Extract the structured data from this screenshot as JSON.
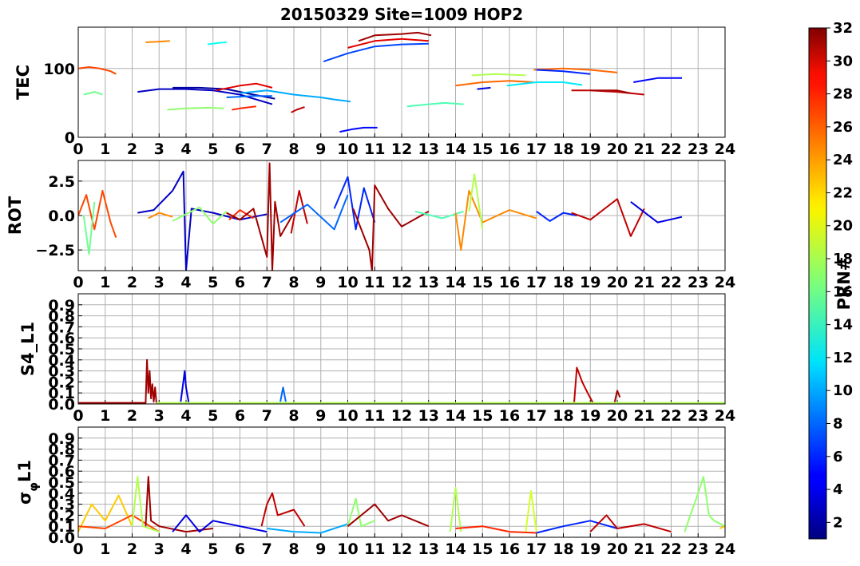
{
  "title": "20150329 Site=1009 HOP2",
  "colorbar": {
    "label": "PRN#",
    "min": 1,
    "max": 32,
    "ticks": [
      2,
      4,
      6,
      8,
      10,
      12,
      14,
      16,
      18,
      20,
      22,
      24,
      26,
      28,
      30,
      32
    ],
    "tick_labels": [
      "2",
      "4",
      "6",
      "8",
      "10",
      "12",
      "14",
      "16",
      "18",
      "20",
      "22",
      "24",
      "26",
      "28",
      "30",
      "32"
    ],
    "colormap": "jet"
  },
  "chart_data": [
    {
      "type": "line",
      "ylabel": "TEC",
      "xlim": [
        0,
        24
      ],
      "ylim": [
        0,
        160
      ],
      "xticks": [
        "0",
        "1",
        "2",
        "3",
        "4",
        "5",
        "6",
        "7",
        "8",
        "9",
        "10",
        "11",
        "12",
        "13",
        "14",
        "15",
        "16",
        "17",
        "18",
        "19",
        "20",
        "21",
        "22",
        "23",
        "24"
      ],
      "yticks": [
        0,
        100
      ],
      "ytick_labels": [
        "0",
        "100"
      ],
      "grid": true,
      "series": [
        {
          "prn": 26,
          "x": [
            0,
            0.4,
            0.8,
            1.2,
            1.4
          ],
          "y": [
            100,
            102,
            100,
            96,
            92
          ]
        },
        {
          "prn": 16,
          "x": [
            0.2,
            0.6,
            0.9
          ],
          "y": [
            62,
            66,
            62
          ]
        },
        {
          "prn": 24,
          "x": [
            2.5,
            3,
            3.4
          ],
          "y": [
            138,
            139,
            140
          ]
        },
        {
          "prn": 13,
          "x": [
            4.8,
            5.2,
            5.5
          ],
          "y": [
            135,
            137,
            138
          ]
        },
        {
          "prn": 3,
          "x": [
            2.2,
            3,
            4,
            5,
            6,
            7.2
          ],
          "y": [
            66,
            70,
            70,
            68,
            62,
            48
          ]
        },
        {
          "prn": 2,
          "x": [
            3.5,
            4.5,
            5.5,
            6.5,
            7.3
          ],
          "y": [
            72,
            72,
            70,
            62,
            56
          ]
        },
        {
          "prn": 17,
          "x": [
            3.3,
            4,
            4.8,
            5.4
          ],
          "y": [
            40,
            42,
            43,
            42
          ]
        },
        {
          "prn": 27,
          "x": [
            5.7,
            6,
            6.6
          ],
          "y": [
            40,
            42,
            45
          ]
        },
        {
          "prn": 29,
          "x": [
            5.1,
            6,
            6.6,
            7.2
          ],
          "y": [
            68,
            75,
            78,
            72
          ]
        },
        {
          "prn": 10,
          "x": [
            6,
            7,
            8,
            9,
            9.5,
            10.1
          ],
          "y": [
            64,
            68,
            62,
            58,
            55,
            52
          ]
        },
        {
          "prn": 8,
          "x": [
            5.5,
            6.5,
            7.2
          ],
          "y": [
            58,
            60,
            60
          ]
        },
        {
          "prn": 30,
          "x": [
            7.9,
            8.1,
            8.4
          ],
          "y": [
            36,
            40,
            44
          ]
        },
        {
          "prn": 7,
          "x": [
            9.1,
            10,
            11,
            12,
            13
          ],
          "y": [
            110,
            122,
            132,
            135,
            136
          ]
        },
        {
          "prn": 29,
          "x": [
            10,
            11,
            12,
            13
          ],
          "y": [
            130,
            140,
            143,
            140
          ]
        },
        {
          "prn": 31,
          "x": [
            10.4,
            11,
            12,
            12.6,
            13.1
          ],
          "y": [
            140,
            148,
            150,
            152,
            148
          ]
        },
        {
          "prn": 5,
          "x": [
            9.7,
            10.2,
            10.6,
            11.1
          ],
          "y": [
            8,
            12,
            14,
            14
          ]
        },
        {
          "prn": 15,
          "x": [
            12.2,
            13,
            13.6,
            14.3
          ],
          "y": [
            45,
            48,
            50,
            48
          ]
        },
        {
          "prn": 25,
          "x": [
            14,
            15,
            16,
            16.9
          ],
          "y": [
            75,
            80,
            82,
            80
          ]
        },
        {
          "prn": 18,
          "x": [
            14.6,
            15.5,
            16.6
          ],
          "y": [
            90,
            92,
            90
          ]
        },
        {
          "prn": 4,
          "x": [
            14.8,
            15.3
          ],
          "y": [
            70,
            72
          ]
        },
        {
          "prn": 12,
          "x": [
            15.9,
            17,
            18,
            18.7
          ],
          "y": [
            75,
            80,
            80,
            76
          ]
        },
        {
          "prn": 25,
          "x": [
            16.9,
            18,
            19,
            20
          ],
          "y": [
            98,
            100,
            98,
            94
          ]
        },
        {
          "prn": 6,
          "x": [
            17,
            18,
            19
          ],
          "y": [
            98,
            96,
            92
          ]
        },
        {
          "prn": 30,
          "x": [
            18.3,
            19,
            20,
            21
          ],
          "y": [
            68,
            68,
            66,
            62
          ]
        },
        {
          "prn": 31,
          "x": [
            19,
            20,
            20.5
          ],
          "y": [
            68,
            68,
            64
          ]
        },
        {
          "prn": 5,
          "x": [
            20.6,
            21.5,
            22.4
          ],
          "y": [
            80,
            86,
            86
          ]
        }
      ]
    },
    {
      "type": "line",
      "ylabel": "ROT",
      "xlim": [
        0,
        24
      ],
      "ylim": [
        -4,
        4
      ],
      "xticks": [
        "0",
        "1",
        "2",
        "3",
        "4",
        "5",
        "6",
        "7",
        "8",
        "9",
        "10",
        "11",
        "12",
        "13",
        "14",
        "15",
        "16",
        "17",
        "18",
        "19",
        "20",
        "21",
        "22",
        "23",
        "24"
      ],
      "yticks": [
        -2.5,
        0,
        2.5
      ],
      "ytick_labels": [
        "−2.5",
        "0.0",
        "2.5"
      ],
      "grid": true,
      "series": [
        {
          "prn": 26,
          "x": [
            0,
            0.3,
            0.6,
            0.9,
            1.2,
            1.4
          ],
          "y": [
            0.0,
            1.5,
            -1.0,
            1.8,
            -0.5,
            -1.6
          ]
        },
        {
          "prn": 16,
          "x": [
            0.2,
            0.4,
            0.6
          ],
          "y": [
            0.0,
            -2.8,
            1.0
          ]
        },
        {
          "prn": 3,
          "x": [
            2.2,
            2.8,
            3.5,
            3.9,
            4.0,
            4.2,
            5,
            6,
            7
          ],
          "y": [
            0.2,
            0.4,
            1.8,
            3.2,
            -4.0,
            0.5,
            0.2,
            -0.3,
            0.1
          ]
        },
        {
          "prn": 24,
          "x": [
            2.6,
            3,
            3.5
          ],
          "y": [
            -0.2,
            0.2,
            -0.1
          ]
        },
        {
          "prn": 17,
          "x": [
            3.5,
            4.5,
            5,
            5.5
          ],
          "y": [
            -0.4,
            0.6,
            -0.6,
            0.3
          ]
        },
        {
          "prn": 27,
          "x": [
            5.6,
            6,
            6.5
          ],
          "y": [
            -0.3,
            0.4,
            -0.2
          ]
        },
        {
          "prn": 31,
          "x": [
            5.5,
            6,
            6.5,
            7,
            7.1,
            7.2,
            7.3,
            7.5,
            8
          ],
          "y": [
            0.2,
            -0.3,
            0.5,
            -3.0,
            3.8,
            -4.0,
            1.0,
            -1.5,
            0.2
          ]
        },
        {
          "prn": 30,
          "x": [
            7.9,
            8.2,
            8.5
          ],
          "y": [
            -1.3,
            1.8,
            -0.6
          ]
        },
        {
          "prn": 8,
          "x": [
            7.5,
            8.5,
            9.5,
            10
          ],
          "y": [
            -0.5,
            0.8,
            -1.0,
            1.5
          ]
        },
        {
          "prn": 6,
          "x": [
            9.5,
            10,
            10.3,
            10.6,
            11
          ],
          "y": [
            0.5,
            2.8,
            -1.0,
            2.0,
            -0.5
          ]
        },
        {
          "prn": 31,
          "x": [
            10.2,
            10.8,
            10.9,
            11,
            11.5,
            12,
            13
          ],
          "y": [
            0.5,
            -2.5,
            -4.0,
            2.2,
            0.5,
            -0.8,
            0.3
          ]
        },
        {
          "prn": 15,
          "x": [
            12.5,
            13.5,
            14.3
          ],
          "y": [
            0.3,
            -0.2,
            0.3
          ]
        },
        {
          "prn": 24,
          "x": [
            14,
            14.2,
            14.5,
            15,
            16,
            17
          ],
          "y": [
            0.2,
            -2.5,
            1.8,
            -0.5,
            0.4,
            -0.2
          ]
        },
        {
          "prn": 18,
          "x": [
            14.5,
            14.7,
            15
          ],
          "y": [
            0.3,
            3.0,
            -1.0
          ]
        },
        {
          "prn": 6,
          "x": [
            17,
            17.5,
            18,
            18.5
          ],
          "y": [
            0.3,
            -0.4,
            0.2,
            0.0
          ]
        },
        {
          "prn": 30,
          "x": [
            18.3,
            19,
            20,
            20.5,
            21
          ],
          "y": [
            0.2,
            -0.3,
            1.2,
            -1.5,
            0.5
          ]
        },
        {
          "prn": 4,
          "x": [
            20.5,
            21.5,
            22.4
          ],
          "y": [
            1.0,
            -0.5,
            -0.1
          ]
        }
      ]
    },
    {
      "type": "line",
      "ylabel": "S4_L1",
      "xlim": [
        0,
        24
      ],
      "ylim": [
        0,
        1.0
      ],
      "xticks": [
        "0",
        "1",
        "2",
        "3",
        "4",
        "5",
        "6",
        "7",
        "8",
        "9",
        "10",
        "11",
        "12",
        "13",
        "14",
        "15",
        "16",
        "17",
        "18",
        "19",
        "20",
        "21",
        "22",
        "23",
        "24"
      ],
      "yticks": [
        0.0,
        0.1,
        0.2,
        0.3,
        0.4,
        0.5,
        0.6,
        0.7,
        0.8,
        0.9
      ],
      "ytick_labels": [
        "0.0",
        "0.1",
        "0.2",
        "0.3",
        "0.4",
        "0.5",
        "0.6",
        "0.7",
        "0.8",
        "0.9"
      ],
      "grid": true,
      "series": [
        {
          "prn": 31,
          "x": [
            0,
            2.5,
            2.55,
            2.6,
            2.65,
            2.7,
            2.75,
            2.8,
            2.85,
            2.9
          ],
          "y": [
            0.01,
            0.01,
            0.4,
            0.1,
            0.3,
            0.05,
            0.18,
            0.02,
            0.15,
            0.01
          ]
        },
        {
          "prn": 4,
          "x": [
            3.8,
            3.9,
            3.95,
            4.0,
            4.1
          ],
          "y": [
            0.02,
            0.2,
            0.3,
            0.15,
            0.01
          ]
        },
        {
          "prn": 8,
          "x": [
            7.5,
            7.6,
            7.7
          ],
          "y": [
            0.02,
            0.15,
            0.02
          ]
        },
        {
          "prn": 30,
          "x": [
            18.4,
            18.5,
            18.7,
            18.9,
            19.1
          ],
          "y": [
            0.01,
            0.33,
            0.2,
            0.1,
            0.01
          ]
        },
        {
          "prn": 31,
          "x": [
            19.9,
            20,
            20.1
          ],
          "y": [
            0.01,
            0.12,
            0.06
          ]
        },
        {
          "prn": 18,
          "x": [
            2.9,
            10,
            20,
            24
          ],
          "y": [
            0.01,
            0.01,
            0.01,
            0.01
          ]
        }
      ]
    },
    {
      "type": "line",
      "ylabel": "σφL1",
      "xlim": [
        0,
        24
      ],
      "ylim": [
        0,
        1.0
      ],
      "xticks": [
        "0",
        "1",
        "2",
        "3",
        "4",
        "5",
        "6",
        "7",
        "8",
        "9",
        "10",
        "11",
        "12",
        "13",
        "14",
        "15",
        "16",
        "17",
        "18",
        "19",
        "20",
        "21",
        "22",
        "23",
        "24"
      ],
      "yticks": [
        0.0,
        0.1,
        0.2,
        0.3,
        0.4,
        0.5,
        0.6,
        0.7,
        0.8,
        0.9
      ],
      "ytick_labels": [
        "0.0",
        "0.1",
        "0.2",
        "0.3",
        "0.4",
        "0.5",
        "0.6",
        "0.7",
        "0.8",
        "0.9"
      ],
      "grid": true,
      "series": [
        {
          "prn": 22,
          "x": [
            0,
            0.5,
            1,
            1.5,
            2
          ],
          "y": [
            0.05,
            0.3,
            0.15,
            0.38,
            0.1
          ]
        },
        {
          "prn": 26,
          "x": [
            0,
            1,
            2,
            3
          ],
          "y": [
            0.1,
            0.08,
            0.2,
            0.05
          ]
        },
        {
          "prn": 18,
          "x": [
            2,
            2.2,
            2.4,
            3
          ],
          "y": [
            0.1,
            0.55,
            0.1,
            0.05
          ]
        },
        {
          "prn": 31,
          "x": [
            2.5,
            2.6,
            2.7,
            3,
            4,
            5
          ],
          "y": [
            0.1,
            0.55,
            0.15,
            0.1,
            0.05,
            0.08
          ]
        },
        {
          "prn": 4,
          "x": [
            3.5,
            4,
            4.5,
            5,
            6,
            7
          ],
          "y": [
            0.05,
            0.2,
            0.05,
            0.15,
            0.1,
            0.05
          ]
        },
        {
          "prn": 30,
          "x": [
            6.8,
            7,
            7.2,
            7.4,
            8,
            8.4
          ],
          "y": [
            0.1,
            0.3,
            0.4,
            0.2,
            0.25,
            0.1
          ]
        },
        {
          "prn": 10,
          "x": [
            7,
            8,
            9,
            10
          ],
          "y": [
            0.08,
            0.05,
            0.04,
            0.12
          ]
        },
        {
          "prn": 17,
          "x": [
            10,
            10.3,
            10.5,
            11
          ],
          "y": [
            0.1,
            0.35,
            0.1,
            0.15
          ]
        },
        {
          "prn": 31,
          "x": [
            10,
            11,
            11.5,
            12,
            13
          ],
          "y": [
            0.1,
            0.3,
            0.15,
            0.2,
            0.1
          ]
        },
        {
          "prn": 18,
          "x": [
            13.8,
            14,
            14.2
          ],
          "y": [
            0.05,
            0.45,
            0.05
          ]
        },
        {
          "prn": 27,
          "x": [
            14,
            15,
            16,
            17
          ],
          "y": [
            0.08,
            0.1,
            0.05,
            0.04
          ]
        },
        {
          "prn": 19,
          "x": [
            16.6,
            16.8,
            17
          ],
          "y": [
            0.05,
            0.42,
            0.05
          ]
        },
        {
          "prn": 6,
          "x": [
            17,
            18,
            19,
            20
          ],
          "y": [
            0.04,
            0.1,
            0.15,
            0.08
          ]
        },
        {
          "prn": 30,
          "x": [
            19,
            19.6,
            20,
            21,
            22
          ],
          "y": [
            0.05,
            0.2,
            0.08,
            0.12,
            0.05
          ]
        },
        {
          "prn": 17,
          "x": [
            22.5,
            23,
            23.2,
            23.4,
            23.6,
            24
          ],
          "y": [
            0.05,
            0.4,
            0.55,
            0.2,
            0.15,
            0.1
          ]
        },
        {
          "prn": 22,
          "x": [
            23.8,
            24
          ],
          "y": [
            0.08,
            0.1
          ]
        }
      ]
    }
  ]
}
